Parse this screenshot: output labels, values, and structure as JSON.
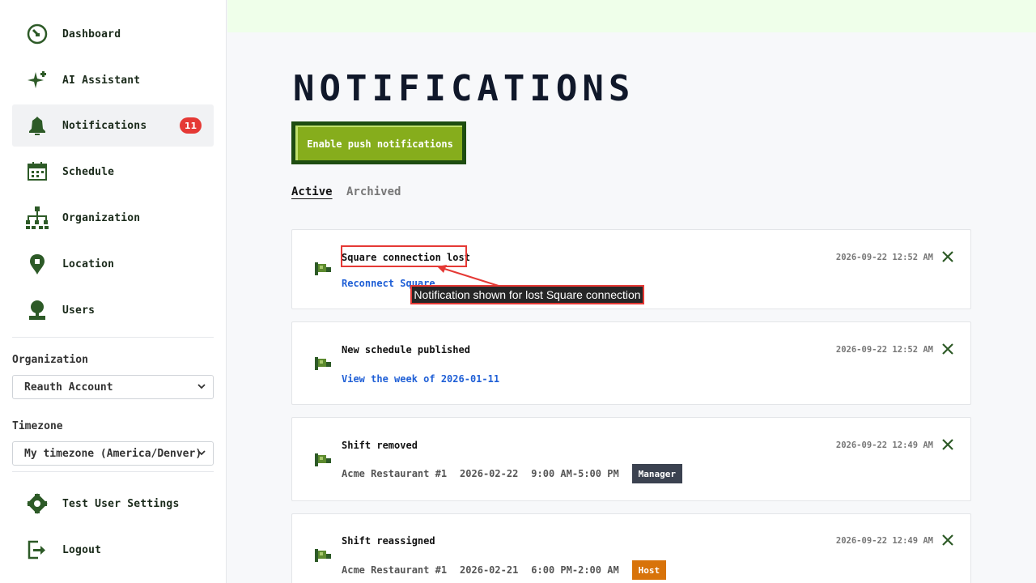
{
  "sidebar": {
    "nav": [
      {
        "label": "Dashboard",
        "icon": "dashboard-icon"
      },
      {
        "label": "AI Assistant",
        "icon": "sparkle-icon"
      },
      {
        "label": "Notifications",
        "icon": "bell-icon",
        "badge": "11",
        "active": true
      },
      {
        "label": "Schedule",
        "icon": "calendar-icon"
      },
      {
        "label": "Organization",
        "icon": "org-chart-icon"
      },
      {
        "label": "Location",
        "icon": "location-pin-icon"
      },
      {
        "label": "Users",
        "icon": "user-icon"
      }
    ],
    "organization_label": "Organization",
    "organization_value": "Reauth Account",
    "timezone_label": "Timezone",
    "timezone_value": "My timezone (America/Denver)",
    "settings_label": "Test User Settings",
    "logout_label": "Logout"
  },
  "main": {
    "title": "NOTIFICATIONS",
    "push_button": "Enable push notifications",
    "tabs": [
      {
        "label": "Active",
        "active": true
      },
      {
        "label": "Archived",
        "active": false
      }
    ],
    "notifications": [
      {
        "title": "Square connection lost",
        "link": "Reconnect Square",
        "time": "2026-09-22 12:52 AM"
      },
      {
        "title": "New schedule published",
        "link": "View the week of 2026-01-11",
        "time": "2026-09-22 12:52 AM"
      },
      {
        "title": "Shift removed",
        "location": "Acme Restaurant #1",
        "date": "2026-02-22",
        "hours": "9:00 AM-5:00 PM",
        "role": "Manager",
        "time": "2026-09-22 12:49 AM"
      },
      {
        "title": "Shift reassigned",
        "location": "Acme Restaurant #1",
        "date": "2026-02-21",
        "hours": "6:00 PM-2:00 AM",
        "role": "Host",
        "time": "2026-09-22 12:49 AM"
      }
    ]
  },
  "annotation": {
    "label": "Notification shown for lost Square connection"
  },
  "colors": {
    "accent_green": "#1e4d10",
    "button_green": "#86ad1c",
    "badge_red": "#e53935",
    "link_blue": "#1f5fd6",
    "manager_badge": "#3b4250",
    "host_badge": "#d8730a",
    "annotation_red": "#e53935"
  }
}
